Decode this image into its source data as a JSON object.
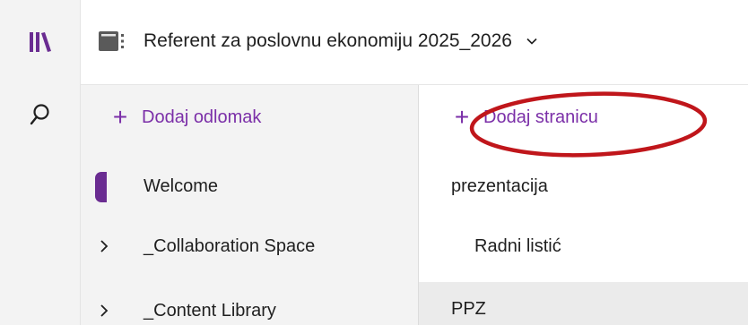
{
  "header": {
    "notebook_title": "Referent za poslovnu ekonomiju 2025_2026"
  },
  "rail": {
    "notebooks_icon": "notebooks-library-icon",
    "search_icon": "search-icon"
  },
  "sections": {
    "add_label": "Dodaj odlomak",
    "items": [
      {
        "label": "Welcome",
        "color": "#6a2c91",
        "expandable": false
      },
      {
        "label": "_Collaboration Space",
        "expandable": true
      },
      {
        "label": "_Content Library",
        "expandable": true
      }
    ]
  },
  "pages": {
    "add_label": "Dodaj stranicu",
    "items": [
      {
        "label": "prezentacija",
        "selected": false
      },
      {
        "label": "Radni listić",
        "selected": false
      },
      {
        "label": "PPZ",
        "selected": true
      }
    ]
  },
  "colors": {
    "accent": "#7b2fa8",
    "section_tab": "#6a2c91",
    "annotation_circle": "#c0161b"
  }
}
